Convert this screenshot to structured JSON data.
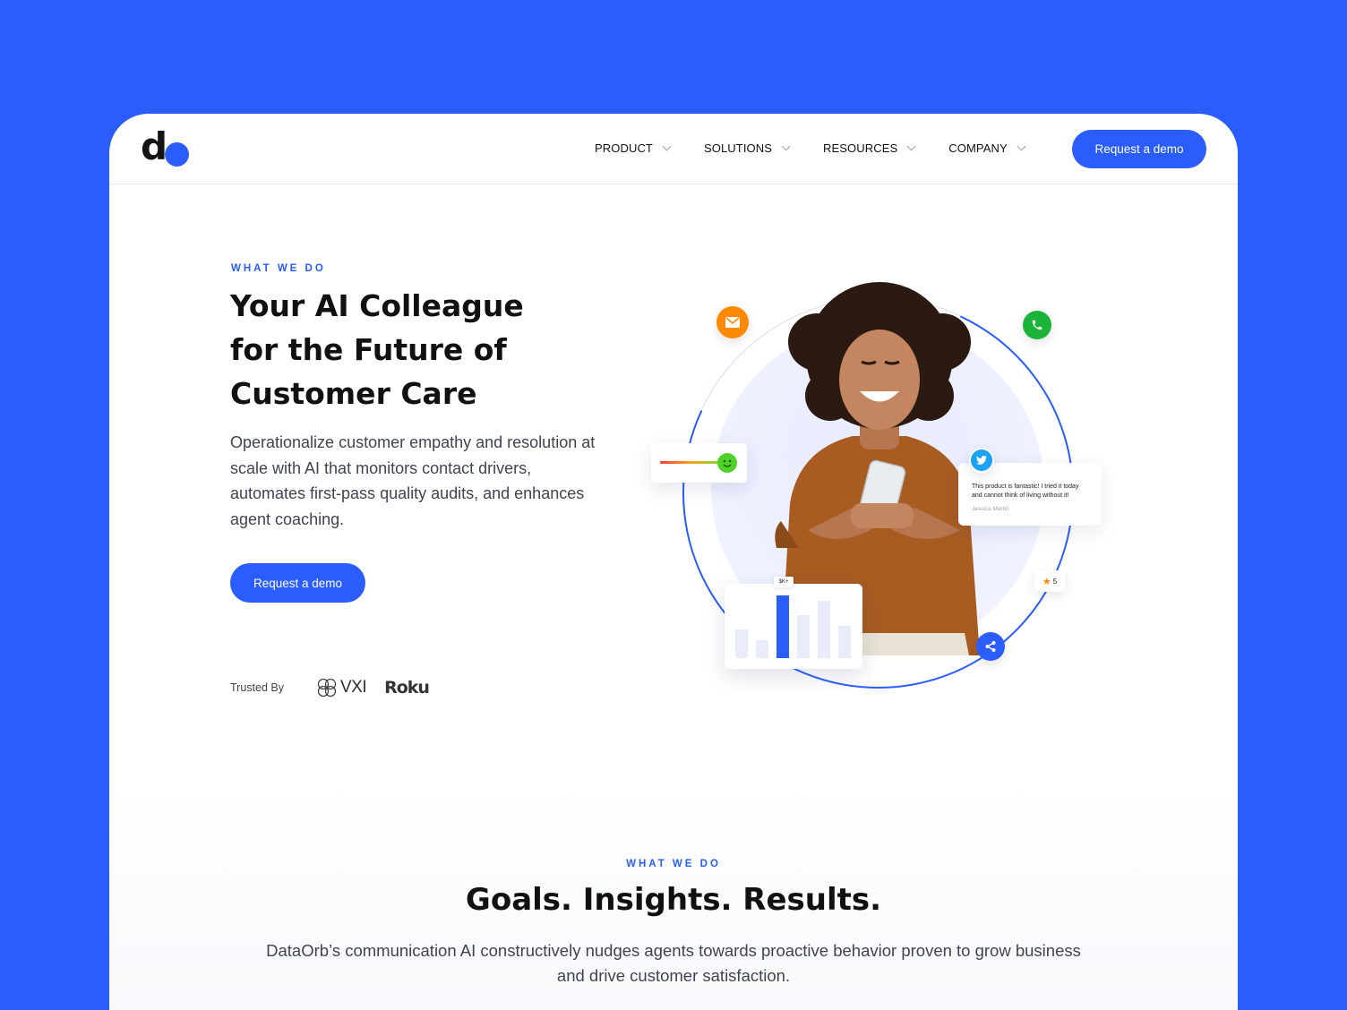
{
  "colors": {
    "accent": "#2a5dfb",
    "background": "#2a5dfb",
    "text": "#111111",
    "body_text": "#3f4450"
  },
  "header": {
    "logo": "do",
    "nav": [
      {
        "label": "PRODUCT",
        "icon": "chevron-down-icon"
      },
      {
        "label": "SOLUTIONS",
        "icon": "chevron-down-icon"
      },
      {
        "label": "RESOURCES",
        "icon": "chevron-down-icon"
      },
      {
        "label": "COMPANY",
        "icon": "chevron-down-icon"
      }
    ],
    "cta_label": "Request a demo"
  },
  "hero": {
    "eyebrow": "WHAT WE DO",
    "title_lines": [
      "Your AI Colleague",
      "for the Future of",
      "Customer Care"
    ],
    "description": "Operationalize customer empathy and resolution at scale with AI that monitors contact drivers, automates first-pass quality audits, and enhances agent coaching.",
    "cta_label": "Request a demo",
    "trusted_label": "Trusted By",
    "trusted_logos": [
      "VXI",
      "Roku"
    ]
  },
  "illustration": {
    "tweet_text": "This product is fantastic! I tried it today and cannot think of living without it!",
    "tweet_author": "Jessica Martin",
    "rating_value": "5",
    "chart_tag": "$K+",
    "chart_bar_levels": [
      0.4,
      0.25,
      0.88,
      0.6,
      0.8,
      0.45
    ],
    "icons": [
      "mail-icon",
      "phone-icon",
      "share-icon",
      "twitter-icon",
      "smiley-icon",
      "star-icon"
    ]
  },
  "section2": {
    "eyebrow": "WHAT WE DO",
    "title": "Goals. Insights. Results.",
    "description": "DataOrb’s communication AI constructively nudges agents towards proactive behavior proven to grow business and drive customer satisfaction."
  }
}
